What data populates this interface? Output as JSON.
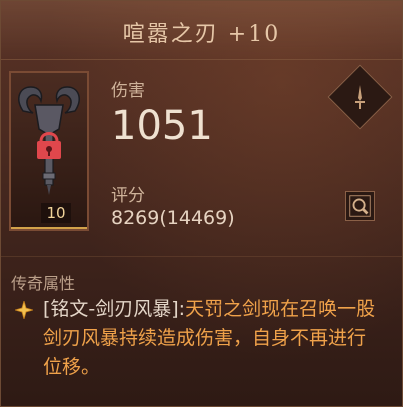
{
  "item": {
    "title": "喧嚣之刃 +10",
    "level": "10"
  },
  "stats": {
    "damage_label": "伤害",
    "damage_value": "1051",
    "score_label": "评分",
    "score_value": "8269(14469)"
  },
  "legendary": {
    "section_title": "传奇属性",
    "affix_name": "[铭文-剑刃风暴]:",
    "affix_description": "天罚之剑现在召唤一股剑刃风暴持续造成伤害，自身不再进行位移。"
  },
  "icons": {
    "item": "horned-key-icon",
    "lock": "lock-icon",
    "sword": "sword-icon",
    "compare": "compare-magnifier-icon",
    "affix": "star-diamond-icon"
  },
  "colors": {
    "affix_description": "#f0a24a",
    "level_text": "#f1d49a",
    "lock": "#e0474c"
  }
}
